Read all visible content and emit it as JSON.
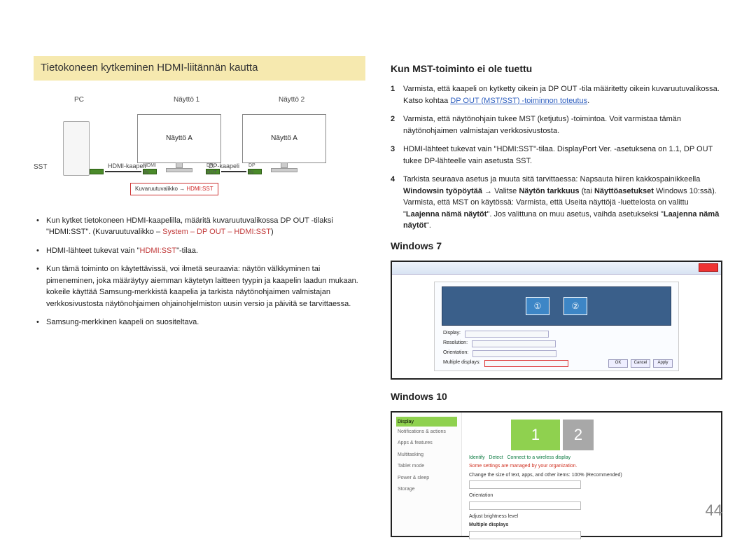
{
  "left": {
    "title": "Tietokoneen kytkeminen HDMI-liitännän kautta",
    "diagram": {
      "pc": "PC",
      "monitor1": "Näyttö 1",
      "monitor2": "Näyttö 2",
      "display_a": "Näyttö A",
      "sst": "SST",
      "hdmi_cable": "HDMI-kaapeli",
      "dp_cable": "DP-kaapeli",
      "hdmi_in": "HDMI IN",
      "dp_out": "DP OUT",
      "dp_in": "DP IN",
      "osd_prefix": "Kuvaruutuvalikko → ",
      "osd_red": "HDMI:SST"
    },
    "bullets": [
      {
        "pre": "Kun kytket tietokoneen HDMI-kaapelilla, määritä kuvaruutuvalikossa DP OUT -tilaksi \"HDMI:SST\". (Kuvaruutuvalikko – ",
        "red": "System – DP OUT – HDMI:SST",
        "post": ")"
      },
      {
        "pre": "HDMI-lähteet tukevat vain \"",
        "red": "HDMI:SST",
        "post": "\"-tilaa."
      },
      {
        "pre": "Kun tämä toiminto on käytettävissä, voi ilmetä seuraavia: näytön välkkyminen tai pimeneminen, joka määräytyy aiemman käytetyn laitteen tyypin ja kaapelin laadun mukaan. kokeile käyttää Samsung-merkkistä kaapelia ja tarkista näytönohjaimen valmistajan verkkosivustosta näytönohjaimen ohjainohjelmiston uusin versio ja päivitä se tarvittaessa.",
        "red": "",
        "post": ""
      },
      {
        "pre": "Samsung-merkkinen kaapeli on suositeltava.",
        "red": "",
        "post": ""
      }
    ]
  },
  "right": {
    "mst_heading": "Kun MST-toiminto ei ole tuettu",
    "steps": [
      {
        "n": "1",
        "text": "Varmista, että kaapeli on kytketty oikein ja DP OUT -tila määritetty oikein kuvaruutuvalikossa. Katso kohtaa ",
        "link": "DP OUT (MST/SST) -toiminnon toteutus",
        "after": "."
      },
      {
        "n": "2",
        "text": "Varmista, että näytönohjain tukee MST (ketjutus) -toimintoa. Voit varmistaa tämän näytönohjaimen valmistajan verkkosivustosta.",
        "link": "",
        "after": ""
      },
      {
        "n": "3",
        "text": "HDMI-lähteet tukevat vain \"HDMI:SST\"-tilaa. DisplayPort Ver. -asetuksena on 1.1, DP OUT tukee DP-lähteelle vain asetusta SST.",
        "link": "",
        "after": ""
      },
      {
        "n": "4",
        "text_parts": [
          "Tarkista seuraava asetus ja muuta sitä tarvittaessa: Napsauta hiiren kakkospainikkeella ",
          "Windowsin työpöytää",
          " → Valitse ",
          "Näytön tarkkuus",
          " (tai ",
          "Näyttöasetukset",
          " Windows 10:ssä). Varmista, että MST on käytössä: Varmista, että Useita näyttöjä -luettelosta on valittu \"",
          "Laajenna nämä näytöt",
          "\". Jos valittuna on muu asetus, vaihda asetukseksi \"",
          "Laajenna nämä näytöt",
          "\"."
        ]
      }
    ],
    "win7_heading": "Windows 7",
    "win10_heading": "Windows 10",
    "win10_sidebar": [
      "Display",
      "Notifications & actions",
      "Apps & features",
      "Multitasking",
      "Tablet mode",
      "Power & sleep",
      "Storage"
    ],
    "win10_display_active": "Display"
  },
  "page_number": "44"
}
